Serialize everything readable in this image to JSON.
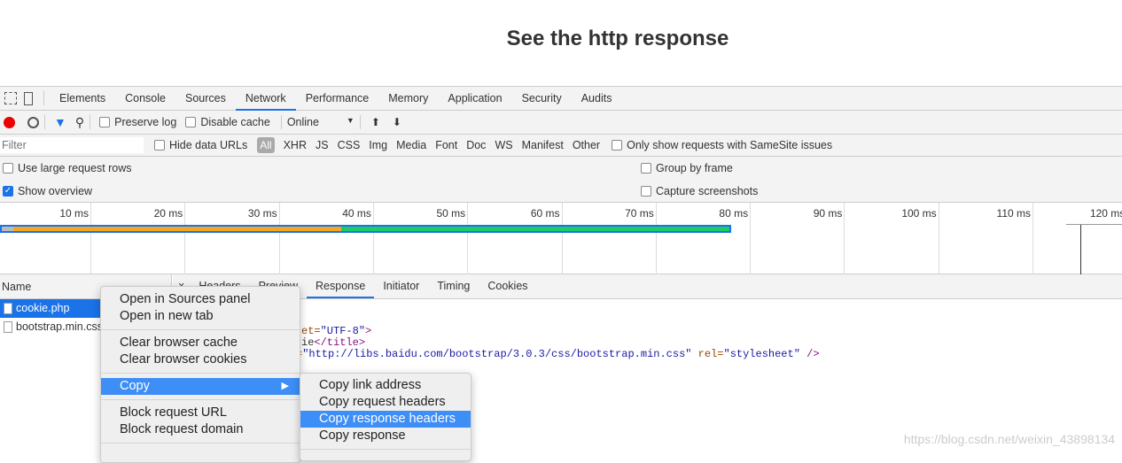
{
  "page_title": "See the http response",
  "devtools": {
    "tabs": [
      "Elements",
      "Console",
      "Sources",
      "Network",
      "Performance",
      "Memory",
      "Application",
      "Security",
      "Audits"
    ],
    "active_tab": "Network",
    "toolbar": {
      "preserve_log": "Preserve log",
      "disable_cache": "Disable cache",
      "throttle": "Online"
    },
    "filter": {
      "placeholder": "Filter",
      "hide_data_urls": "Hide data URLs",
      "types": [
        "All",
        "XHR",
        "JS",
        "CSS",
        "Img",
        "Media",
        "Font",
        "Doc",
        "WS",
        "Manifest",
        "Other"
      ],
      "samesite": "Only show requests with SameSite issues"
    },
    "options": {
      "large_rows": "Use large request rows",
      "group_by_frame": "Group by frame",
      "show_overview": "Show overview",
      "capture_screenshots": "Capture screenshots",
      "show_overview_checked": true
    },
    "timeline": {
      "ticks": [
        "10 ms",
        "20 ms",
        "30 ms",
        "40 ms",
        "50 ms",
        "60 ms",
        "70 ms",
        "80 ms",
        "90 ms",
        "100 ms",
        "110 ms",
        "120 ms"
      ],
      "colors": {
        "waiting": "#f5a623",
        "download": "#1fca6b",
        "border": "#1a73e8"
      }
    },
    "requests": {
      "header": "Name",
      "items": [
        "cookie.php",
        "bootstrap.min.css"
      ],
      "selected": "cookie.php"
    },
    "detail_tabs": [
      "×",
      "Headers",
      "Preview",
      "Response",
      "Initiator",
      "Timing",
      "Cookies"
    ],
    "active_detail_tab": "Response",
    "code": {
      "line1a": "et=",
      "line1b": "\"UTF-8\"",
      "line1c": ">",
      "line2a": "ie",
      "line2b": "</title>",
      "line3a": "=",
      "line3b": "\"http://libs.baidu.com/bootstrap/3.0.3/css/bootstrap.min.css\"",
      "line3c": " rel=",
      "line3d": "\"stylesheet\"",
      "line3e": " />"
    }
  },
  "context_menu": {
    "items": [
      "Open in Sources panel",
      "Open in new tab",
      "Clear browser cache",
      "Clear browser cookies",
      "Copy",
      "Block request URL",
      "Block request domain"
    ],
    "highlighted": "Copy"
  },
  "submenu": {
    "items": [
      "Copy link address",
      "Copy request headers",
      "Copy response headers",
      "Copy response"
    ],
    "highlighted": "Copy response headers"
  },
  "watermark": "https://blog.csdn.net/weixin_43898134"
}
